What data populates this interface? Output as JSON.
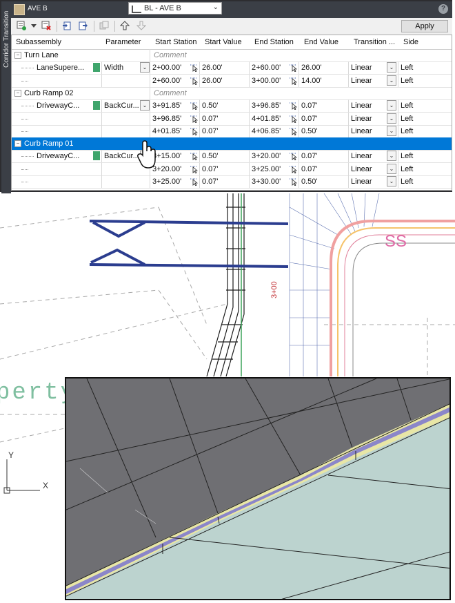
{
  "palette": {
    "side_tab": "Corridor Transition",
    "title": "AVE B",
    "baseline_dropdown": "BL - AVE B",
    "help_label": "?",
    "apply_label": "Apply",
    "toolbar_icons": [
      "add-transition-icon",
      "dropdown-arrow-icon",
      "delete-transition-icon",
      "import-icon",
      "export-icon",
      "copy-icon",
      "move-up-icon",
      "move-down-icon"
    ]
  },
  "grid": {
    "columns": [
      "Subassembly",
      "Parameter",
      "Start Station",
      "Start Value",
      "End Station",
      "End Value",
      "Transition ...",
      "Side"
    ],
    "groups": [
      {
        "name": "Turn Lane",
        "comment": "Comment",
        "subassembly": "LaneSupere...",
        "parameter": "Width",
        "rows": [
          {
            "start_station": "2+00.00'",
            "start_value": "26.00'",
            "end_station": "2+60.00'",
            "end_value": "26.00'",
            "transition": "Linear",
            "side": "Left"
          },
          {
            "start_station": "2+60.00'",
            "start_value": "26.00'",
            "end_station": "3+00.00'",
            "end_value": "14.00'",
            "transition": "Linear",
            "side": "Left"
          }
        ]
      },
      {
        "name": "Curb Ramp 02",
        "comment": "Comment",
        "subassembly": "DrivewayC...",
        "parameter": "BackCur...",
        "rows": [
          {
            "start_station": "3+91.85'",
            "start_value": "0.50'",
            "end_station": "3+96.85'",
            "end_value": "0.07'",
            "transition": "Linear",
            "side": "Left"
          },
          {
            "start_station": "3+96.85'",
            "start_value": "0.07'",
            "end_station": "4+01.85'",
            "end_value": "0.07'",
            "transition": "Linear",
            "side": "Left"
          },
          {
            "start_station": "4+01.85'",
            "start_value": "0.07'",
            "end_station": "4+06.85'",
            "end_value": "0.50'",
            "transition": "Linear",
            "side": "Left"
          }
        ]
      },
      {
        "name": "Curb Ramp 01",
        "comment": "",
        "subassembly": "DrivewayC...",
        "parameter": "BackCur...",
        "rows": [
          {
            "start_station": "3+15.00'",
            "start_value": "0.50'",
            "end_station": "3+20.00'",
            "end_value": "0.07'",
            "transition": "Linear",
            "side": "Left"
          },
          {
            "start_station": "3+20.00'",
            "start_value": "0.07'",
            "end_station": "3+25.00'",
            "end_value": "0.07'",
            "transition": "Linear",
            "side": "Left"
          },
          {
            "start_station": "3+25.00'",
            "start_value": "0.07'",
            "end_station": "3+30.00'",
            "end_value": "0.50'",
            "transition": "Linear",
            "side": "Left"
          }
        ]
      }
    ]
  },
  "drawing": {
    "station_label": "3+00",
    "property_label": "perty",
    "ss_label": "SS",
    "axis_y": "Y",
    "axis_x": "X"
  },
  "colors": {
    "selection": "#0078d7",
    "station_text": "#c0282d",
    "alignment_blue": "#2b3d8f",
    "curb_yellow": "#e8e6a6",
    "curb_purple": "#8b86c9"
  }
}
